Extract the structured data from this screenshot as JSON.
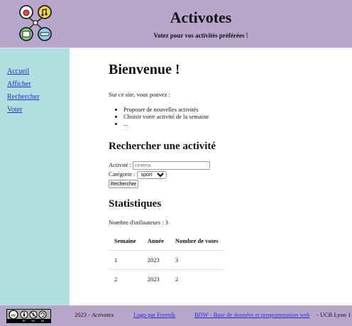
{
  "header": {
    "title": "Activotes",
    "subtitle": "Votez pour vos activités préférées !"
  },
  "sidebar": {
    "items": [
      {
        "label": "Accueil"
      },
      {
        "label": "Afficher"
      },
      {
        "label": "Rechercher"
      },
      {
        "label": "Voter"
      }
    ]
  },
  "main": {
    "welcome_title": "Bienvenue !",
    "intro": "Sur ce site, vous pouvez :",
    "features": [
      "Proposer de nouvelles activités",
      "Choisir votre activité de la semaine",
      "..."
    ],
    "search": {
      "title": "Rechercher une activité",
      "activity_label": "Activité :",
      "activity_placeholder": "cinéma",
      "category_label": "Catégorie :",
      "category_selected": "sport",
      "submit_label": "Rechercher"
    },
    "stats": {
      "title": "Statistiques",
      "users_text": "Nombre d'utilisateurs : 3",
      "columns": [
        "Semaine",
        "Année",
        "Nombre de votes"
      ],
      "rows": [
        [
          "1",
          "2023",
          "3"
        ],
        [
          "2",
          "2023",
          "2"
        ]
      ]
    }
  },
  "footer": {
    "year": "2023 - ",
    "site": "Activotes",
    "logo_credit": "Logo par Freepik",
    "bdw_link": "BDW - Base de données et programmation web",
    "institution": " - UCB Lyon 1",
    "license_icons": [
      "cc",
      "by",
      "nc",
      "sa"
    ],
    "license_labels": [
      "BY",
      "NC",
      "SA"
    ]
  },
  "colors": {
    "header_bg": "#b7a7cd",
    "sidebar_bg": "#b0dfe0",
    "link": "#2b2bd6"
  }
}
